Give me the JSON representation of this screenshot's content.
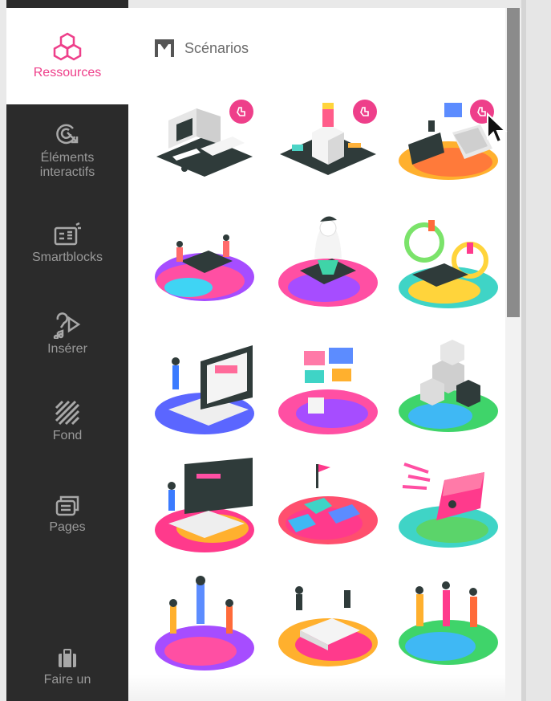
{
  "sidebar": {
    "items": [
      {
        "label": "Ressources",
        "icon": "hexagon-cluster-icon",
        "active": true
      },
      {
        "label": "Éléments interactifs",
        "icon": "click-target-icon",
        "active": false
      },
      {
        "label": "Smartblocks",
        "icon": "smartblock-icon",
        "active": false
      },
      {
        "label": "Insérer",
        "icon": "media-insert-icon",
        "active": false
      },
      {
        "label": "Fond",
        "icon": "hatched-background-icon",
        "active": false
      },
      {
        "label": "Pages",
        "icon": "pages-stack-icon",
        "active": false
      },
      {
        "label": "Faire un",
        "icon": "briefcase-icon",
        "active": false
      }
    ]
  },
  "section": {
    "title": "Scénarios",
    "icon": "scenario-frame-icon"
  },
  "colors": {
    "accent": "#ee3f8a",
    "sidebar_bg": "#2b2b2b",
    "sidebar_text": "#9a9a9a"
  },
  "tiles": [
    {
      "name": "desktop-computer-scene",
      "premium": true
    },
    {
      "name": "cube-station-scene",
      "premium": true
    },
    {
      "name": "laptop-presentation-scene",
      "premium": true
    },
    {
      "name": "team-meeting-scene",
      "premium": false
    },
    {
      "name": "giant-person-phone-scene",
      "premium": false
    },
    {
      "name": "chat-bubbles-scene",
      "premium": false
    },
    {
      "name": "teacher-laptop-scene",
      "premium": false
    },
    {
      "name": "media-screens-scene",
      "premium": false
    },
    {
      "name": "boxes-stack-scene",
      "premium": false
    },
    {
      "name": "classroom-board-scene",
      "premium": false
    },
    {
      "name": "puzzle-pieces-scene",
      "premium": false
    },
    {
      "name": "pencil-rocket-scene",
      "premium": false
    },
    {
      "name": "group-people-scene",
      "premium": false
    },
    {
      "name": "table-collab-scene",
      "premium": false
    },
    {
      "name": "team-celebration-scene",
      "premium": false
    }
  ]
}
